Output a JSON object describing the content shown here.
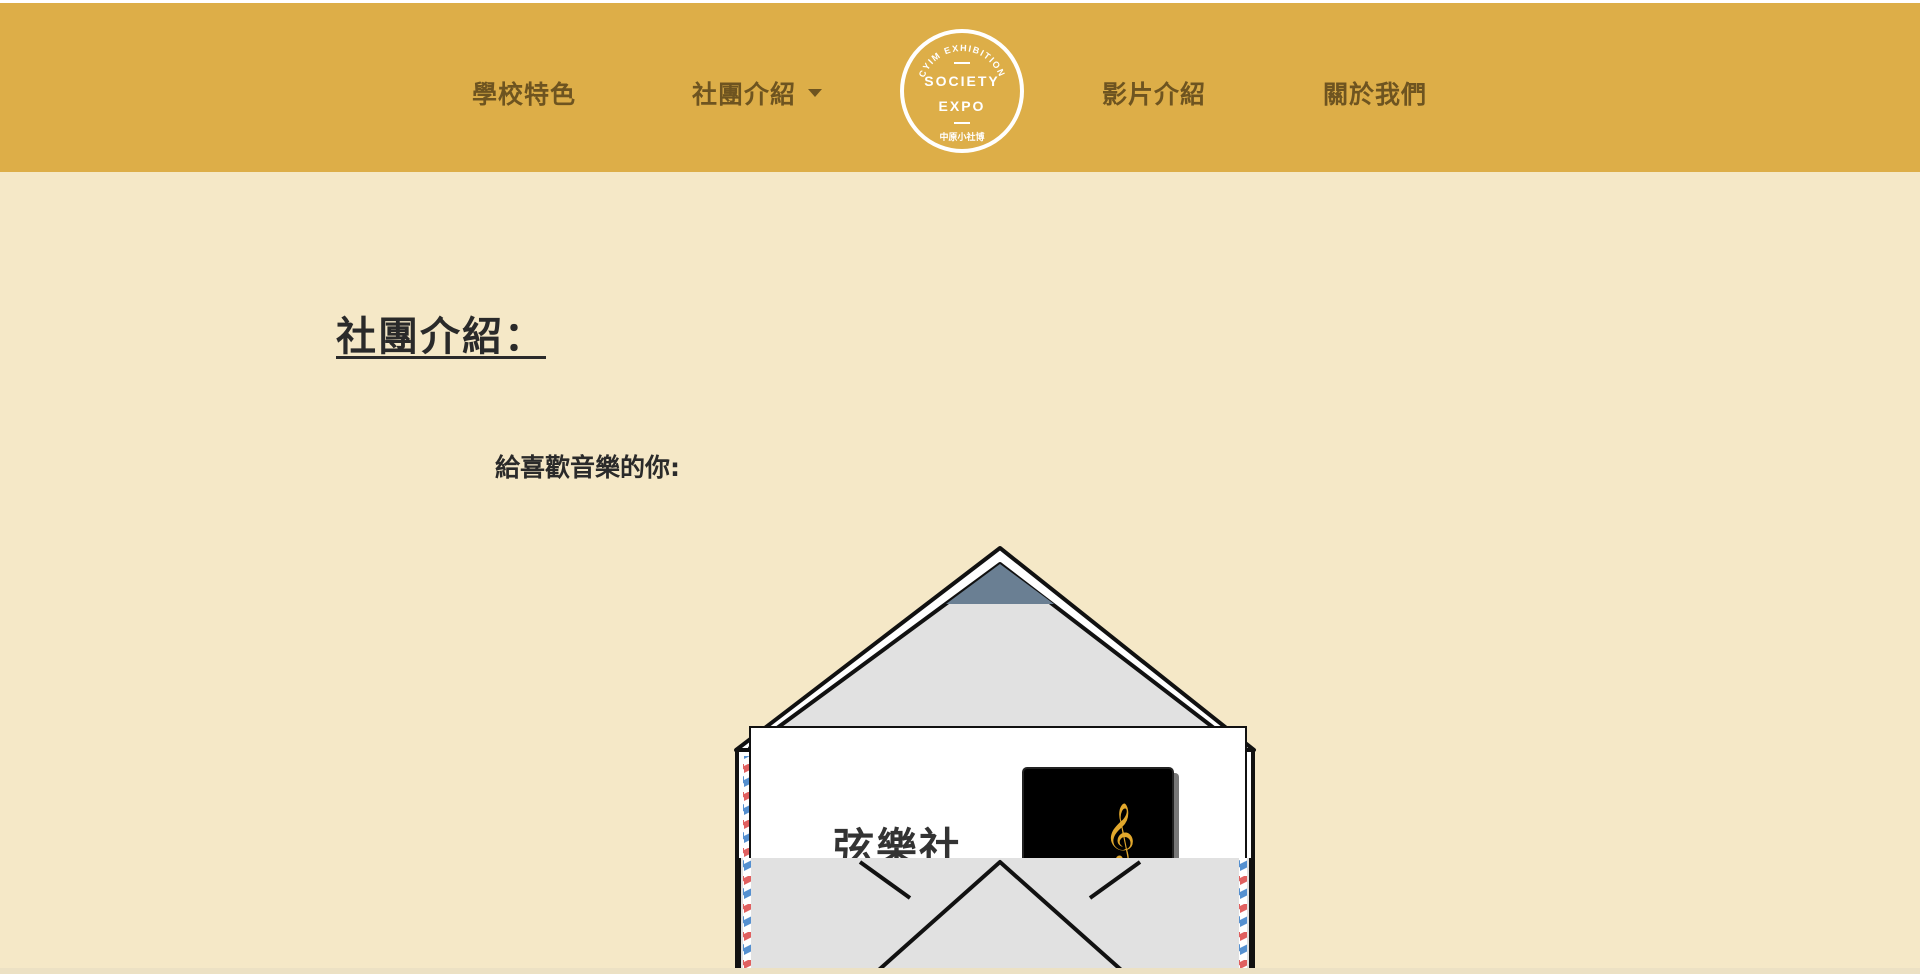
{
  "nav": {
    "items": [
      {
        "label": "學校特色"
      },
      {
        "label": "社團介紹"
      },
      {
        "label": "影片介紹"
      },
      {
        "label": "關於我們"
      }
    ],
    "logo": {
      "top_text": "CYIM EXHIBITION",
      "line1": "SOCIETY",
      "line2": "EXPO",
      "bottom_text": "中原小社博"
    }
  },
  "main": {
    "title": "社團介紹：",
    "intro": "給喜歡音樂的你:",
    "card": {
      "title": "弦樂社",
      "icon": "treble-clef-icon"
    }
  },
  "colors": {
    "header_bg": "#ddae48",
    "nav_text": "#6e5420",
    "page_bg": "#f5e8c7",
    "accent": "#e2a82d"
  }
}
